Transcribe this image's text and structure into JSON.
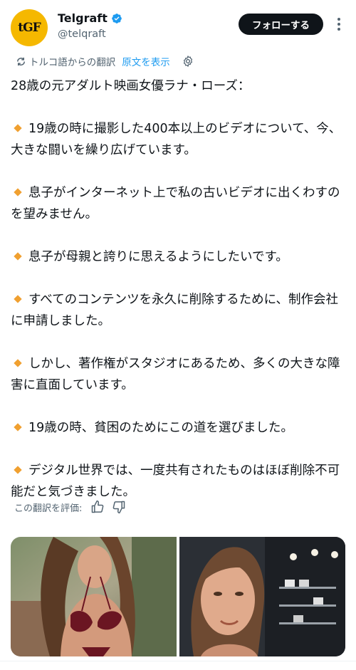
{
  "account": {
    "avatar_text": "tGF",
    "name": "Telgraft",
    "handle": "@telqraft",
    "verified": true
  },
  "actions": {
    "follow_label": "フォローする",
    "more_icon": "more-vertical-icon"
  },
  "translation": {
    "from_label": "トルコ語からの翻訳",
    "show_original_label": "原文を表示",
    "settings_icon": "gear-icon"
  },
  "tweet": {
    "intro": "28歳の元アダルト映画女優ラナ・ローズ：",
    "points": [
      "19歳の時に撮影した400本以上のビデオについて、今、大きな闘いを繰り広げています。",
      "息子がインターネット上で私の古いビデオに出くわすのを望みません。",
      "息子が母親と誇りに思えるようにしたいです。",
      "すべてのコンテンツを永久に削除するために、制作会社に申請しました。",
      "しかし、著作権がスタジオにあるため、多くの大きな障害に直面しています。",
      "19歳の時、貧困のためにこの道を選びました。",
      "デジタル世界では、一度共有されたものはほぼ削除不可能だと気づきました。"
    ]
  },
  "rating": {
    "label": "この翻訳を評価:",
    "up_icon": "thumbs-up-icon",
    "down_icon": "thumbs-down-icon"
  },
  "colors": {
    "text": "#0f1419",
    "secondary": "#536471",
    "link": "#1d9bf0",
    "bullet": "#f0a030",
    "avatar_bg": "#f5b800",
    "button_bg": "#0f1419"
  }
}
